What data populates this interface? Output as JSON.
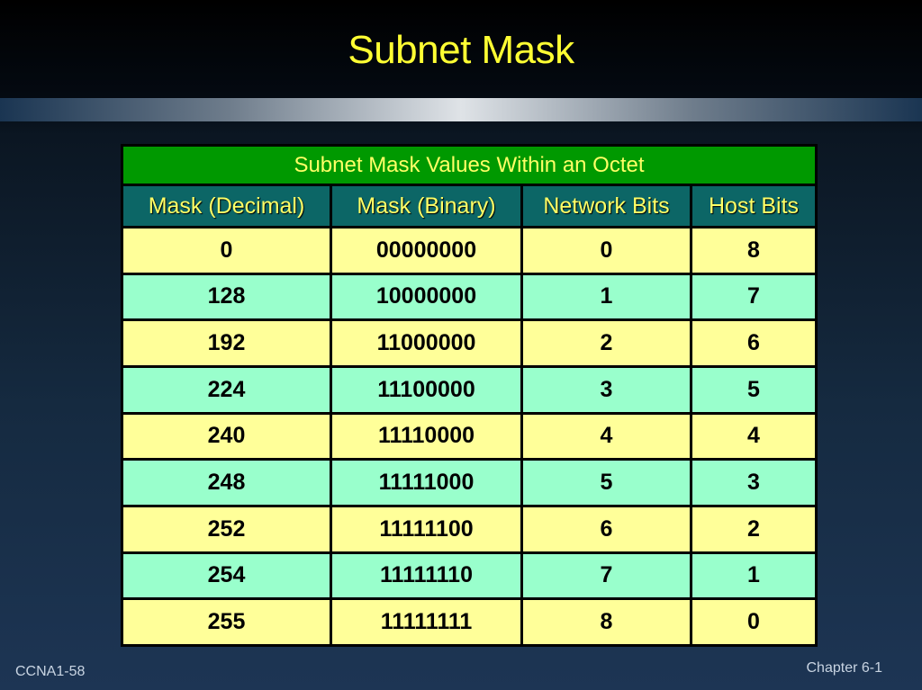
{
  "slide": {
    "title": "Subnet Mask",
    "footer_left": "CCNA1-58",
    "footer_right": "Chapter 6-1"
  },
  "colors": {
    "title": "#ffff33",
    "caption_bg": "#009900",
    "header_bg": "#0c6666",
    "header_text": "#ffff66",
    "row_yellow": "#ffff99",
    "row_green": "#99ffcc"
  },
  "table": {
    "caption": "Subnet Mask Values Within an Octet",
    "headers": [
      "Mask (Decimal)",
      "Mask (Binary)",
      "Network Bits",
      "Host Bits"
    ],
    "rows": [
      [
        "0",
        "00000000",
        "0",
        "8"
      ],
      [
        "128",
        "10000000",
        "1",
        "7"
      ],
      [
        "192",
        "11000000",
        "2",
        "6"
      ],
      [
        "224",
        "11100000",
        "3",
        "5"
      ],
      [
        "240",
        "11110000",
        "4",
        "4"
      ],
      [
        "248",
        "11111000",
        "5",
        "3"
      ],
      [
        "252",
        "11111100",
        "6",
        "2"
      ],
      [
        "254",
        "11111110",
        "7",
        "1"
      ],
      [
        "255",
        "11111111",
        "8",
        "0"
      ]
    ]
  }
}
